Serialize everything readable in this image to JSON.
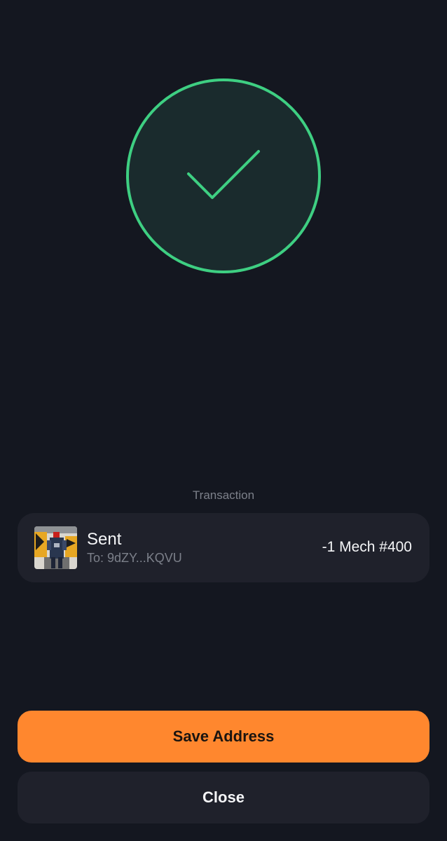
{
  "status": {
    "icon": "check-circle-icon",
    "accent_color": "#3ecf82",
    "fill_color": "#1a2b2d"
  },
  "transaction": {
    "section_label": "Transaction",
    "title": "Sent",
    "recipient": "To: 9dZY...KQVU",
    "amount": "-1 Mech #400",
    "thumbnail": "nft-thumbnail-image"
  },
  "actions": {
    "save_address_label": "Save Address",
    "close_label": "Close",
    "primary_color": "#ff872e"
  }
}
